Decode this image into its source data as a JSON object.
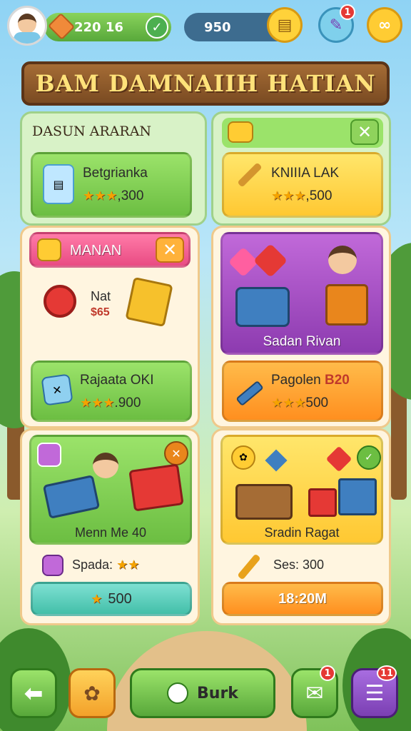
{
  "header": {
    "currency_main": "220 16",
    "currency_secondary": "950",
    "notification_count": "1"
  },
  "banner": {
    "title": "BAM DAMNAIIH HATIAN"
  },
  "section_title": "DASUN ARARAN",
  "cards": {
    "top_left": {
      "title": "Betgrianka",
      "value": ",300"
    },
    "top_right": {
      "title": "KNIIIA LAK",
      "value": ",500"
    },
    "mid_left_header": "MANAN",
    "mid_left_item": {
      "label": "Nat",
      "price": "$65"
    },
    "mid_left_reward": {
      "title": "Rajaata OKI",
      "value": ".900"
    },
    "mid_right_item": "Sadan Rivan",
    "mid_right_reward": {
      "title": "Pagolen",
      "code": "B20",
      "value": "500"
    },
    "bot_left_item": "Menn Me 40",
    "bot_left_label": "Spada:",
    "bot_left_button": "500",
    "bot_right_item": "Sradin Ragat",
    "bot_right_label": "Ses: 300",
    "bot_right_button": "18:20M"
  },
  "nav": {
    "center_label": "Burk",
    "chat_badge": "1",
    "menu_badge": "11"
  },
  "icons": [
    "back-arrow-icon",
    "shop-bag-icon",
    "leaf-icon",
    "chat-icon",
    "menu-icon",
    "chest-icon",
    "key-icon",
    "gift-icon",
    "heart-icon",
    "gear-icon",
    "gem-icon"
  ],
  "colors": {
    "accent_green": "#6cbe42",
    "accent_orange": "#ff8f1f",
    "banner_wood": "#7a4b22"
  }
}
